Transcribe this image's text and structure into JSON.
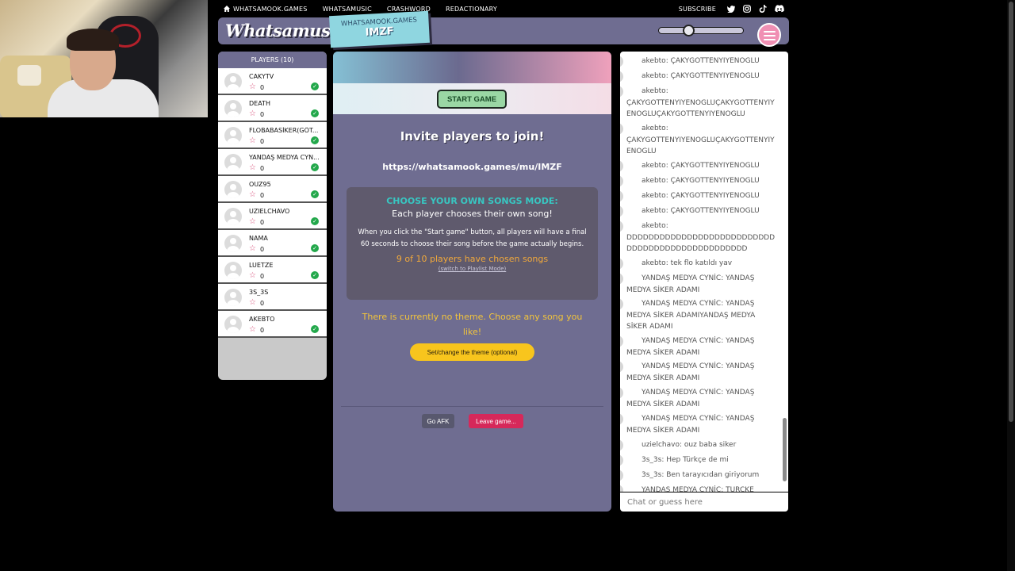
{
  "nav": {
    "items": [
      "WHATSAMOOK.GAMES",
      "WHATSAMUSIC",
      "CRASHWORD",
      "REDACTIONARY"
    ],
    "subscribe": "SUBSCRIBE"
  },
  "header": {
    "logo": "Whatsamusic",
    "room_site": "WHATSAMOOK.GAMES",
    "room_code": "IMZF",
    "volume_level": 0.3
  },
  "players": {
    "title": "PLAYERS (10)",
    "list": [
      {
        "name": "CAKYTV",
        "score": "0",
        "chosen": true
      },
      {
        "name": "DEATH",
        "score": "0",
        "chosen": true
      },
      {
        "name": "FLOBABASİKER(GÖT...",
        "score": "0",
        "chosen": true
      },
      {
        "name": "YANDAŞ MEDYA CYN...",
        "score": "0",
        "chosen": true
      },
      {
        "name": "OUZ95",
        "score": "0",
        "chosen": true
      },
      {
        "name": "UZIELCHAVO",
        "score": "0",
        "chosen": true
      },
      {
        "name": "NAMA",
        "score": "0",
        "chosen": true
      },
      {
        "name": "LUETZE",
        "score": "0",
        "chosen": true
      },
      {
        "name": "3S_3S",
        "score": "0",
        "chosen": false
      },
      {
        "name": "AKEBTO",
        "score": "0",
        "chosen": true
      }
    ]
  },
  "main": {
    "start_button": "START GAME",
    "invite_title": "Invite players to join!",
    "invite_url": "https://whatsamook.games/mu/IMZF",
    "mode_title": "CHOOSE YOUR OWN SONGS MODE:",
    "mode_subtitle": "Each player chooses their own song!",
    "mode_desc": "When you click the \"Start game\" button, all players will have a final 60 seconds to choose their song before the game actually begins.",
    "chosen_status": "9 of 10 players have chosen songs",
    "switch_link": "(switch to Playlist Mode)",
    "theme_text": "There is currently no theme. Choose any song you like!",
    "theme_button": "Set/change the theme (optional)",
    "afk_button": "Go AFK",
    "leave_button": "Leave game..."
  },
  "chat": {
    "placeholder": "Chat or guess here",
    "messages": [
      {
        "text": "akebto: ÇAKYGOTTENYIYENOGLU"
      },
      {
        "text": "akebto: ÇAKYGOTTENYIYENOGLU"
      },
      {
        "text": "akebto: ÇAKYGOTTENYIYENOGLUÇAKYGOTTENYIYENOGLUÇAKYGOTTENYIYENOGLU"
      },
      {
        "text": "akebto: ÇAKYGOTTENYIYENOGLUÇAKYGOTTENYIYENOGLU"
      },
      {
        "text": "akebto: ÇAKYGOTTENYIYENOGLU"
      },
      {
        "text": "akebto: ÇAKYGOTTENYIYENOGLU"
      },
      {
        "text": "akebto: ÇAKYGOTTENYIYENOGLU"
      },
      {
        "text": "akebto: ÇAKYGOTTENYIYENOGLU"
      },
      {
        "text": "akebto: DDDDDDDDDDDDDDDDDDDDDDDDDDDDDDDDDDDDDDDDDDDDDDDDD"
      },
      {
        "text": "akebto: tek flo katıldı yav"
      },
      {
        "text": "YANDAŞ MEDYA CYNİC: YANDAŞ MEDYA SİKER ADAMI"
      },
      {
        "text": "YANDAŞ MEDYA CYNİC: YANDAŞ MEDYA SİKER ADAMIYANDAŞ MEDYA SİKER ADAMI"
      },
      {
        "text": "YANDAŞ MEDYA CYNİC: YANDAŞ MEDYA SİKER ADAMI"
      },
      {
        "text": "YANDAŞ MEDYA CYNİC: YANDAŞ MEDYA SİKER ADAMI"
      },
      {
        "text": "YANDAŞ MEDYA CYNİC: YANDAŞ MEDYA SİKER ADAMI"
      },
      {
        "text": "YANDAŞ MEDYA CYNİC: YANDAŞ MEDYA SİKER ADAMI"
      },
      {
        "text": "uzielchavo: ouz baba siker"
      },
      {
        "text": "3s_3s: Hep Türkçe de mi"
      },
      {
        "text": "3s_3s: Ben tarayıcıdan giriyorum"
      },
      {
        "text": "YANDAŞ MEDYA CYNİC: TURCKE"
      }
    ]
  }
}
